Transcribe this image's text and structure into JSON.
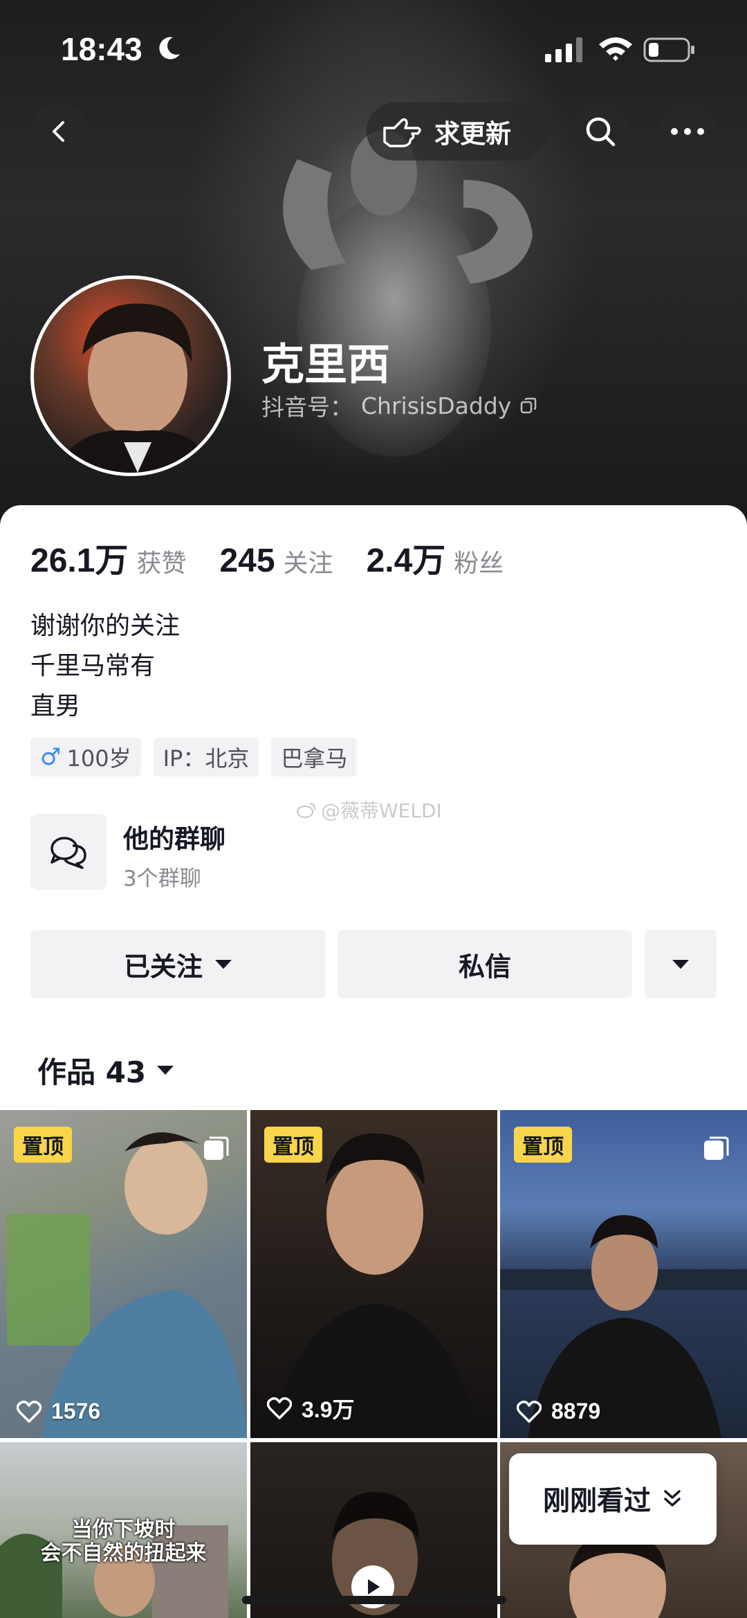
{
  "status_bar": {
    "time": "18:43"
  },
  "header": {
    "update_label": "求更新",
    "nickname": "克里西",
    "douyin_id_label": "抖音号：",
    "douyin_id": "ChrisisDaddy"
  },
  "stats": [
    {
      "value": "26.1万",
      "label": "获赞"
    },
    {
      "value": "245",
      "label": "关注"
    },
    {
      "value": "2.4万",
      "label": "粉丝"
    }
  ],
  "bio": [
    "谢谢你的关注",
    "千里马常有",
    "直男"
  ],
  "tags": {
    "gender_symbol": "♂",
    "age": "100岁",
    "ip": "IP：北京",
    "place": "巴拿马"
  },
  "watermark": "@薇蒂WELDI",
  "group_chat": {
    "title": "他的群聊",
    "subtitle": "3个群聊"
  },
  "actions": {
    "followed": "已关注",
    "message": "私信"
  },
  "works_tab": {
    "label": "作品 43"
  },
  "videos": [
    {
      "pinned": "置顶",
      "likes": "1576"
    },
    {
      "pinned": "置顶",
      "likes": "3.9万"
    },
    {
      "pinned": "置顶",
      "likes": "8879"
    },
    {
      "caption_line1": "当你下坡时",
      "caption_line2": "会不自然的扭起来"
    },
    {},
    {}
  ],
  "recent_button": {
    "label": "刚刚看过"
  },
  "colors": {
    "pin_yellow": "#f8d54a",
    "male_blue": "#3b8df2",
    "chip_bg": "#f2f2f4",
    "text_primary": "#161823",
    "text_secondary": "#8a8b91"
  }
}
